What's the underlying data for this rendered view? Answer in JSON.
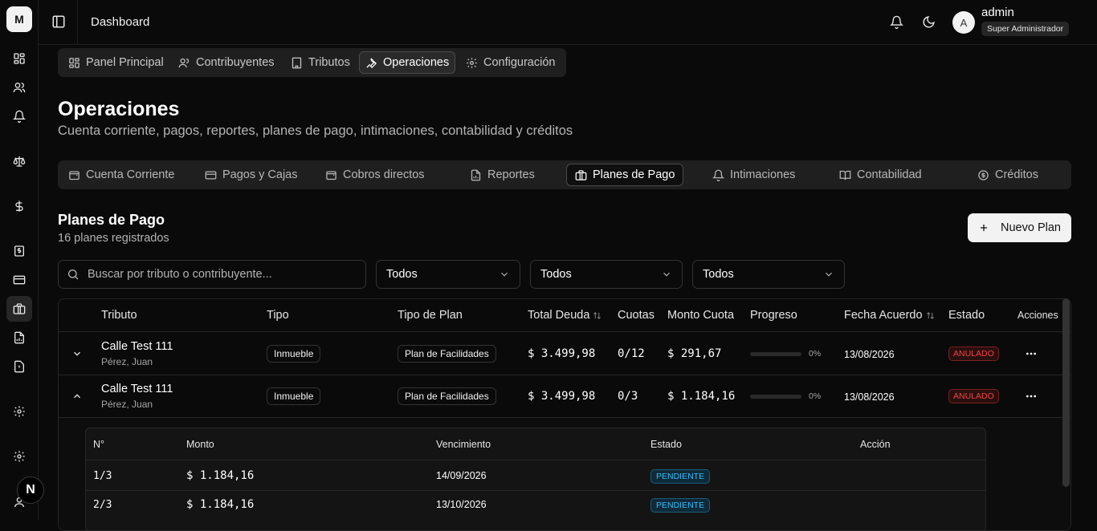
{
  "rail": {
    "logo": "M"
  },
  "topbar": {
    "title": "Dashboard",
    "user_initial": "A",
    "user_name": "admin",
    "user_role": "Super Administrador"
  },
  "main_nav": {
    "items": [
      {
        "label": "Panel Principal",
        "icon": "layout-dashboard-icon"
      },
      {
        "label": "Contribuyentes",
        "icon": "users-icon"
      },
      {
        "label": "Tributos",
        "icon": "building-icon"
      },
      {
        "label": "Operaciones",
        "icon": "wrench-icon",
        "active": true
      },
      {
        "label": "Configuración",
        "icon": "gear-icon"
      }
    ]
  },
  "page": {
    "title": "Operaciones",
    "subtitle": "Cuenta corriente, pagos, reportes, planes de pago, intimaciones, contabilidad y créditos"
  },
  "sub_tabs": {
    "items": [
      {
        "label": "Cuenta Corriente",
        "icon": "wallet-icon"
      },
      {
        "label": "Pagos y Cajas",
        "icon": "credit-card-icon"
      },
      {
        "label": "Cobros directos",
        "icon": "wallet-icon"
      },
      {
        "label": "Reportes",
        "icon": "file-chart-icon"
      },
      {
        "label": "Planes de Pago",
        "icon": "briefcase-icon",
        "active": true
      },
      {
        "label": "Intimaciones",
        "icon": "bell-icon"
      },
      {
        "label": "Contabilidad",
        "icon": "book-icon"
      },
      {
        "label": "Créditos",
        "icon": "coin-icon"
      }
    ]
  },
  "section": {
    "title": "Planes de Pago",
    "subtitle": "16 planes registrados",
    "new_button": "Nuevo Plan"
  },
  "filters": {
    "search_placeholder": "Buscar por tributo o contribuyente...",
    "select_1": "Todos",
    "select_2": "Todos",
    "select_3": "Todos"
  },
  "table": {
    "headers": {
      "tributo": "Tributo",
      "tipo": "Tipo",
      "tipo_plan": "Tipo de Plan",
      "total_deuda": "Total Deuda",
      "cuotas": "Cuotas",
      "monto_cuota": "Monto Cuota",
      "progreso": "Progreso",
      "fecha_acuerdo": "Fecha Acuerdo",
      "estado": "Estado",
      "acciones": "Acciones"
    },
    "rows": [
      {
        "tributo": "Calle Test 111",
        "contribuyente": "Pérez, Juan",
        "tipo": "Inmueble",
        "tipo_plan": "Plan de Facilidades",
        "total_deuda": "$ 3.499,98",
        "cuotas": "0/12",
        "monto_cuota": "$ 291,67",
        "progreso": "0%",
        "progreso_value": 0,
        "fecha_acuerdo": "13/08/2026",
        "estado": "ANULADO",
        "expanded": false
      },
      {
        "tributo": "Calle Test 111",
        "contribuyente": "Pérez, Juan",
        "tipo": "Inmueble",
        "tipo_plan": "Plan de Facilidades",
        "total_deuda": "$ 3.499,98",
        "cuotas": "0/3",
        "monto_cuota": "$ 1.184,16",
        "progreso": "0%",
        "progreso_value": 0,
        "fecha_acuerdo": "13/08/2026",
        "estado": "ANULADO",
        "expanded": true
      }
    ],
    "installments": {
      "headers": {
        "numero": "N°",
        "monto": "Monto",
        "vencimiento": "Vencimiento",
        "estado": "Estado",
        "accion": "Acción"
      },
      "rows": [
        {
          "numero": "1/3",
          "monto": "$ 1.184,16",
          "vencimiento": "14/09/2026",
          "estado": "PENDIENTE"
        },
        {
          "numero": "2/3",
          "monto": "$ 1.184,16",
          "vencimiento": "13/10/2026",
          "estado": "PENDIENTE"
        }
      ]
    }
  },
  "colors": {
    "accent_red": "#ef4444",
    "accent_blue": "#38bdf8",
    "background": "#0a0a0a"
  }
}
